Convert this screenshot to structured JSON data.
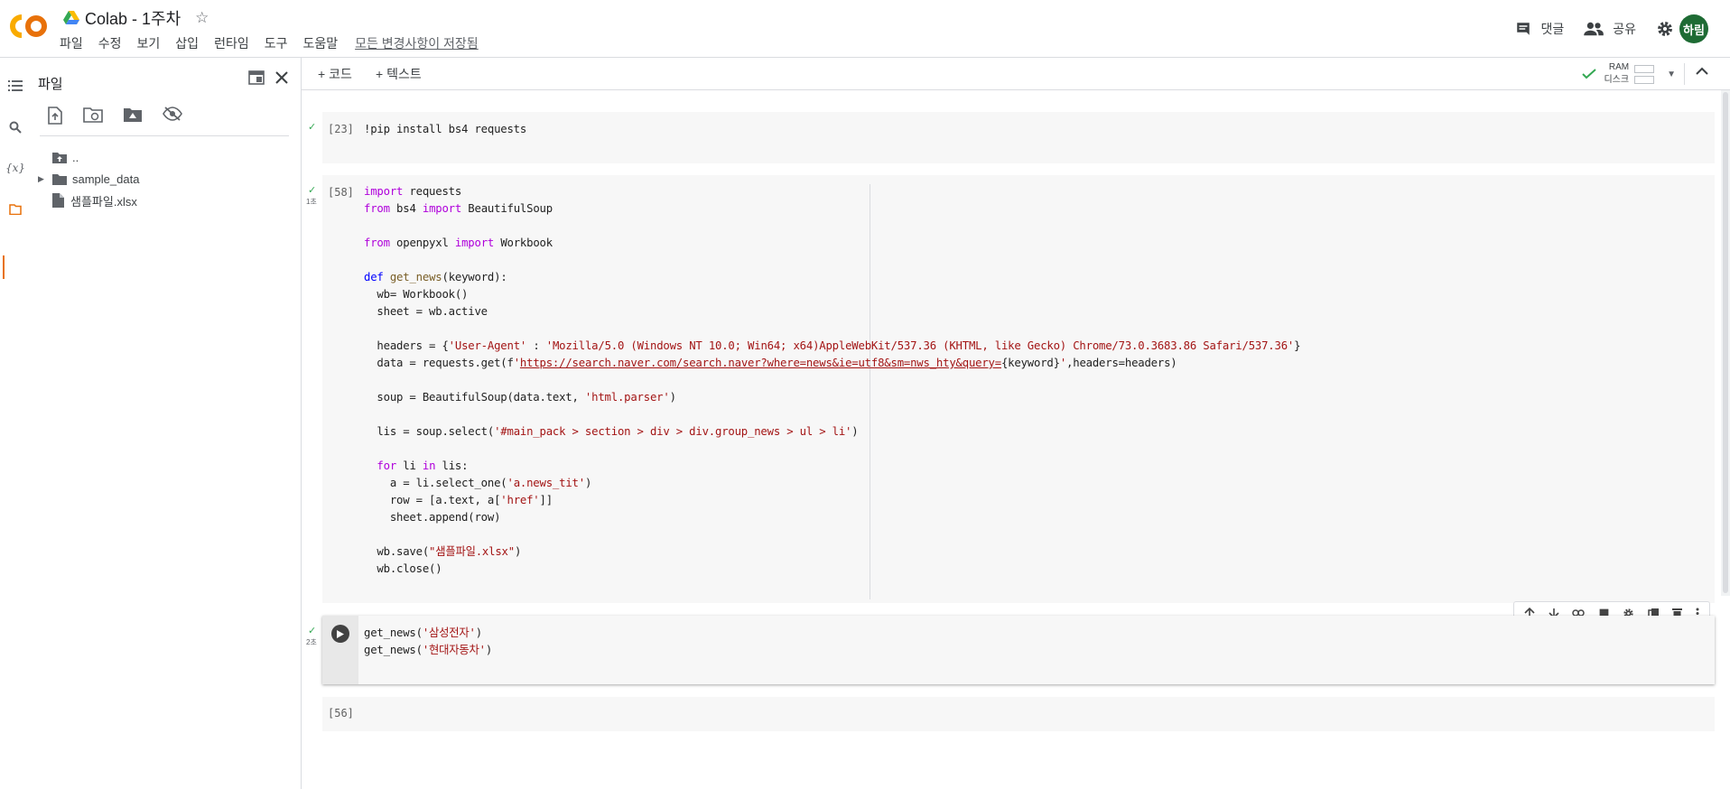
{
  "app": {
    "logo_text": "CO",
    "title": "Colab - 1주차",
    "star_glyph": "☆"
  },
  "menu": [
    "파일",
    "수정",
    "보기",
    "삽입",
    "런타임",
    "도구",
    "도움말"
  ],
  "saved_status": "모든 변경사항이 저장됨",
  "header_right": {
    "comment_label": "댓글",
    "share_label": "공유",
    "avatar_text": "하림"
  },
  "panel": {
    "title": "파일",
    "tree": [
      {
        "name": "..",
        "type": "parent"
      },
      {
        "name": "sample_data",
        "type": "folder"
      },
      {
        "name": "샘플파일.xlsx",
        "type": "file"
      }
    ]
  },
  "toolbar": {
    "add_code": "+ 코드",
    "add_text": "+ 텍스트",
    "ram_label": "RAM",
    "disk_label": "디스크"
  },
  "cells": [
    {
      "number": "[23]",
      "time": "",
      "code": [
        "!pip install bs4 requests"
      ]
    },
    {
      "number": "[58]",
      "time": "1초",
      "code": [
        "import requests",
        "from bs4 import BeautifulSoup",
        "",
        "from openpyxl import Workbook",
        "",
        "def get_news(keyword):",
        "  wb= Workbook()",
        "  sheet = wb.active",
        "",
        "  headers = {'User-Agent' : 'Mozilla/5.0 (Windows NT 10.0; Win64; x64)AppleWebKit/537.36 (KHTML, like Gecko) Chrome/73.0.3683.86 Safari/537.36'}",
        "  data = requests.get(f'https://search.naver.com/search.naver?where=news&ie=utf8&sm=nws_hty&query={keyword}',headers=headers)",
        "",
        "  soup = BeautifulSoup(data.text, 'html.parser')",
        "",
        "  lis = soup.select('#main_pack > section > div > div.group_news > ul > li')",
        "",
        "  for li in lis:",
        "    a = li.select_one('a.news_tit')",
        "    row = [a.text, a['href']]",
        "    sheet.append(row)",
        "",
        "  wb.save(\"샘플파일.xlsx\")",
        "  wb.close()"
      ]
    },
    {
      "number": "",
      "time": "2초",
      "code": [
        "get_news('삼성전자')",
        "get_news('현대자동차')"
      ]
    },
    {
      "number": "[56]",
      "time": "",
      "code": []
    }
  ],
  "colors": {
    "accent_orange": "#e8710a",
    "logo_yellow": "#f9ab00",
    "success_green": "#34a853",
    "avatar_bg": "#1e6b34"
  }
}
